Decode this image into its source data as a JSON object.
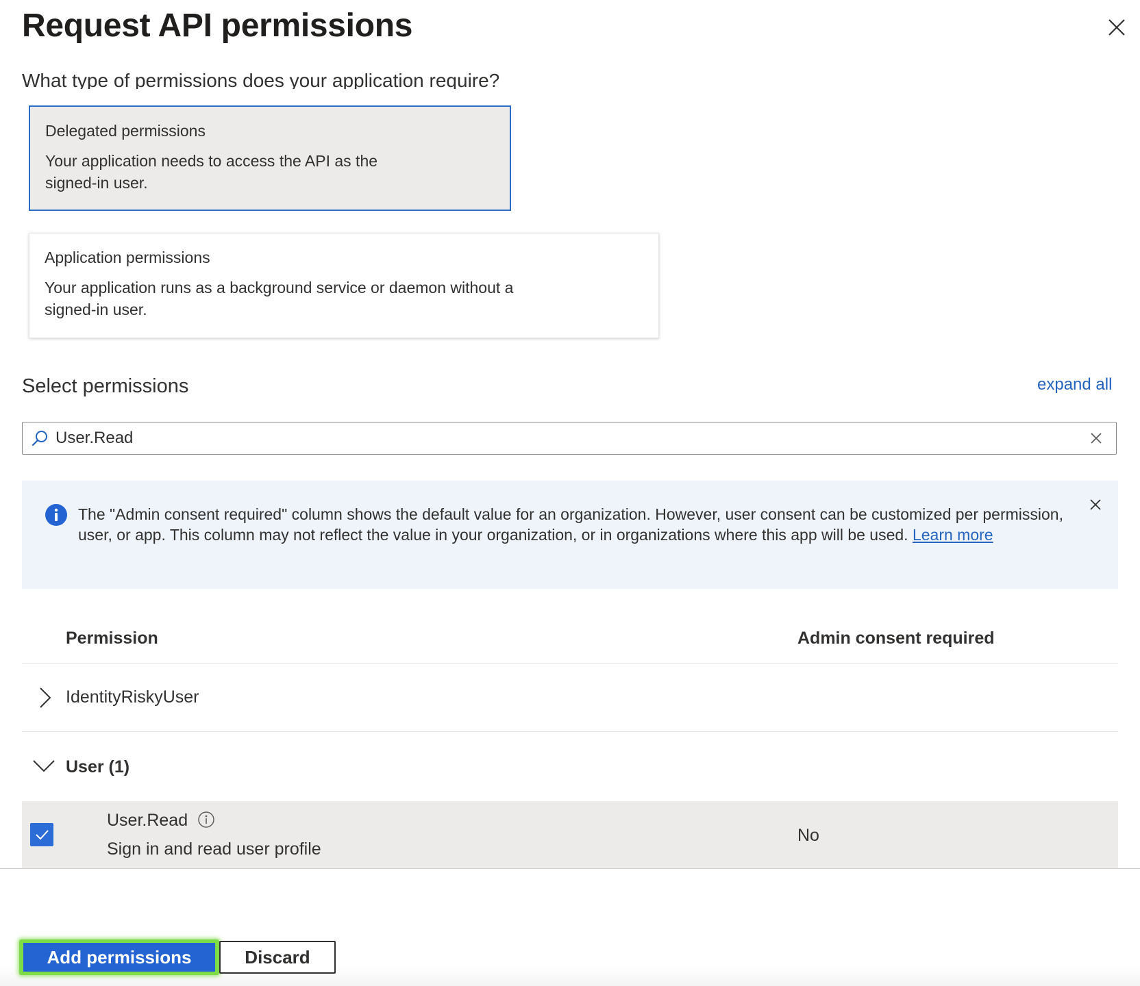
{
  "panel": {
    "title": "Request API permissions",
    "clipped_question": "What type of permissions does your application require?"
  },
  "permission_types": [
    {
      "title": "Delegated permissions",
      "description": "Your application needs to access the API as the signed-in user.",
      "selected": true
    },
    {
      "title": "Application permissions",
      "description": "Your application runs as a background service or daemon without a signed-in user.",
      "selected": false
    }
  ],
  "select": {
    "heading": "Select permissions",
    "expand_all": "expand all",
    "search_value": "User.Read"
  },
  "info_banner": {
    "text": "The \"Admin consent required\" column shows the default value for an organization. However, user consent can be customized per permission, user, or app. This column may not reflect the value in your organization, or in organizations where this app will be used.",
    "link_text": "Learn more"
  },
  "table": {
    "headers": {
      "permission": "Permission",
      "admin_consent": "Admin consent required"
    },
    "groups": [
      {
        "label": "IdentityRiskyUser",
        "expanded": false
      },
      {
        "label": "User (1)",
        "expanded": true
      }
    ],
    "rows": [
      {
        "name": "User.Read",
        "description": "Sign in and read user profile",
        "admin_consent": "No",
        "checked": true
      }
    ]
  },
  "footer": {
    "add_label": "Add permissions",
    "discard_label": "Discard"
  },
  "colors": {
    "accent": "#2364d2",
    "link": "#2364c0",
    "selected_border": "#2b6cc4",
    "highlight_outline": "#7fdc49",
    "info_bg": "#eff4fb"
  },
  "icons": [
    "close-icon",
    "search-icon",
    "clear-icon",
    "info-icon",
    "chevron-right-icon",
    "chevron-down-icon",
    "checkmark-icon",
    "info-circle-icon"
  ]
}
